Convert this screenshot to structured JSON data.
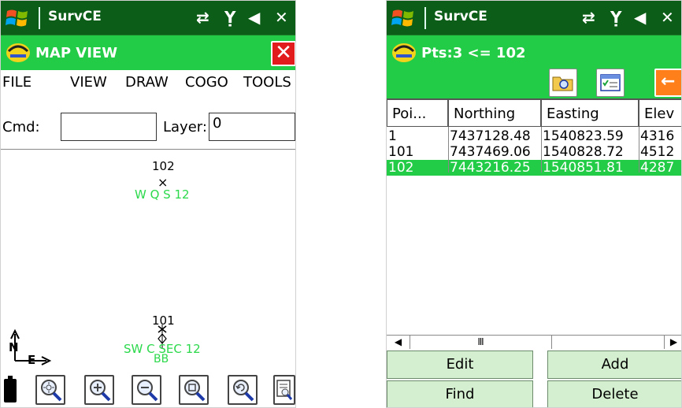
{
  "left": {
    "app_title": "SurvCE",
    "header_title": "MAP VIEW",
    "close_label": "✕",
    "menu": [
      "FILE",
      "VIEW",
      "DRAW",
      "COGO",
      "TOOLS"
    ],
    "cmd_label": "Cmd:",
    "cmd_value": "",
    "layer_label": "Layer:",
    "layer_value": "0",
    "points": [
      {
        "id": "102",
        "desc": "W Q S 12"
      },
      {
        "id": "101",
        "desc": "SW C SEC 12",
        "extra": "BB"
      }
    ],
    "compass_n": "N",
    "compass_e": "E",
    "tools": [
      "zoom-extents-icon",
      "zoom-in-icon",
      "zoom-out-icon",
      "zoom-window-icon",
      "zoom-previous-icon",
      "layers-icon"
    ]
  },
  "right": {
    "app_title": "SurvCE",
    "header_title": "Pts:3 <= 102",
    "columns": [
      "Poi...",
      "Northing",
      "Easting",
      "Elev"
    ],
    "rows": [
      {
        "point": "1",
        "northing": "7437128.48",
        "easting": "1540823.59",
        "elev": "4316"
      },
      {
        "point": "101",
        "northing": "7437469.06",
        "easting": "1540828.72",
        "elev": "4512"
      },
      {
        "point": "102",
        "northing": "7443216.25",
        "easting": "1540851.81",
        "elev": "4287"
      }
    ],
    "selected_row": "102",
    "buttons": {
      "edit": "Edit",
      "add": "Add",
      "find": "Find",
      "delete": "Delete"
    }
  },
  "colors": {
    "title_bar": "#0b5d17",
    "header_bar": "#23cc46",
    "selection": "#23cc46",
    "close_button": "#e21c1c",
    "map_label_green": "#2bd94b",
    "button_face": "#d4efcf"
  }
}
